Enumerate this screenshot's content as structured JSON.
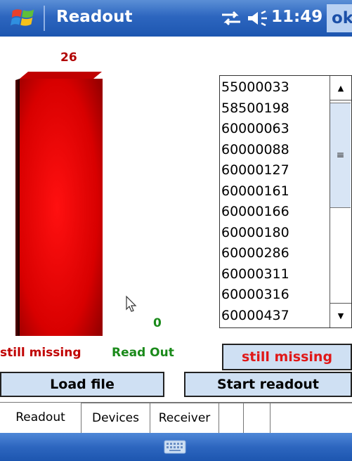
{
  "titlebar": {
    "app_title": "Readout",
    "clock": "11:49",
    "ok_label": "ok",
    "icons": [
      "windows-start-icon",
      "connectivity-icon",
      "volume-icon"
    ]
  },
  "counters": {
    "missing": "26",
    "readout": "0"
  },
  "chart_data": {
    "type": "bar",
    "categories": [
      "still missing",
      "Read Out"
    ],
    "series": [
      {
        "values": [
          26,
          0
        ]
      }
    ],
    "colors": [
      "#e00000",
      "#1a8a1a"
    ]
  },
  "list": {
    "items": [
      "55000033",
      "58500198",
      "60000063",
      "60000088",
      "60000127",
      "60000161",
      "60000166",
      "60000180",
      "60000286",
      "60000311",
      "60000316",
      "60000437"
    ]
  },
  "labels": {
    "still_missing": "still missing",
    "read_out": "Read Out"
  },
  "buttons": {
    "status": "still missing",
    "load_file": "Load file",
    "start_readout": "Start readout"
  },
  "tabs": [
    {
      "label": "Readout"
    },
    {
      "label": "Devices"
    },
    {
      "label": "Receiver"
    },
    {
      "label": ""
    },
    {
      "label": ""
    },
    {
      "label": ""
    }
  ],
  "menubar": {
    "icon": "keyboard-icon"
  },
  "colors": {
    "titlebar": "#2d66bf",
    "button_bg": "#cfe0f3",
    "missing_red": "#c00000",
    "readout_green": "#1a8a1a"
  }
}
